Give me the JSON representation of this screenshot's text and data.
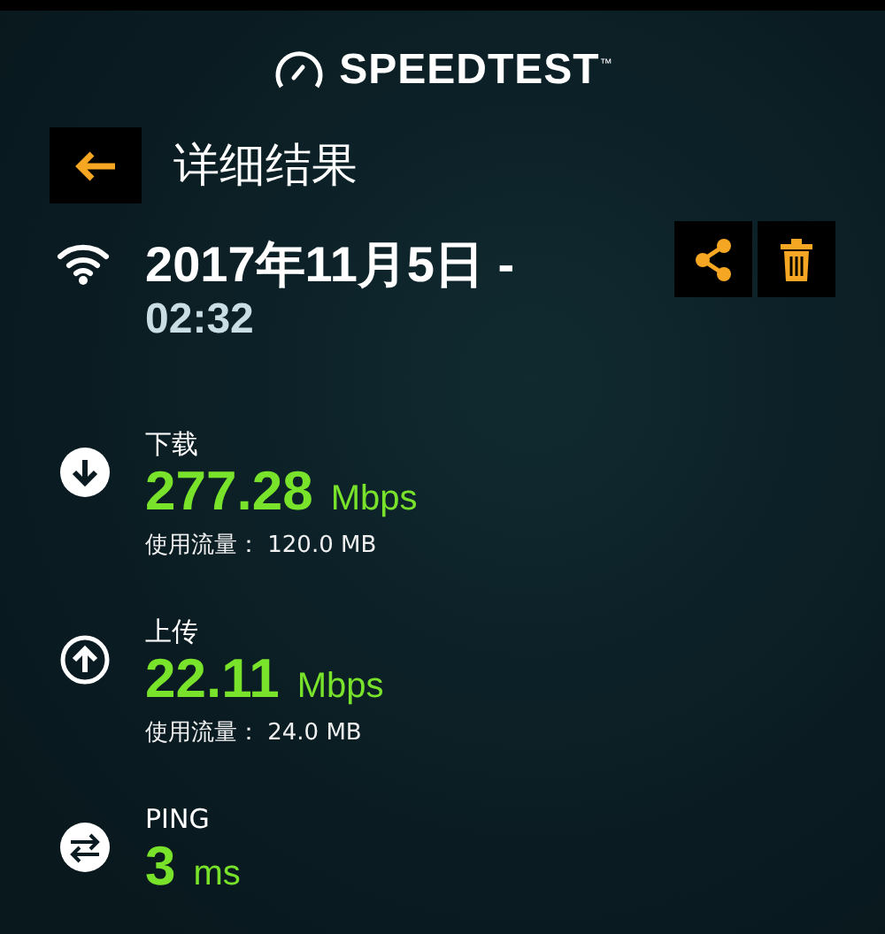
{
  "header": {
    "logo": "SPEEDTEST",
    "trademark": "™"
  },
  "nav": {
    "title": "详细结果"
  },
  "result": {
    "kind": "wifi",
    "date": "2017年11月5日 -",
    "time": "02:32"
  },
  "metrics": [
    {
      "kind": "download",
      "label": "下载",
      "value": "277.28",
      "unit": "Mbps",
      "usage": "使用流量： 120.0 MB"
    },
    {
      "kind": "upload",
      "label": "上传",
      "value": "22.11",
      "unit": "Mbps",
      "usage": "使用流量： 24.0 MB"
    },
    {
      "kind": "ping",
      "label": "PING",
      "value": "3",
      "unit": "ms"
    }
  ]
}
